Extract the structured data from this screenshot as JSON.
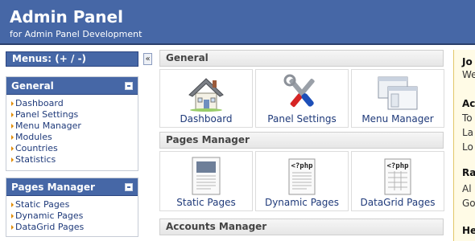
{
  "header": {
    "title": "Admin Panel",
    "subtitle": "for Admin Panel Development"
  },
  "menus_bar": {
    "label": "Menus: (+ / -)"
  },
  "collapse_button": {
    "glyph": "«"
  },
  "sidebar": {
    "general": {
      "title": "General",
      "items": [
        "Dashboard",
        "Panel Settings",
        "Menu Manager",
        "Modules",
        "Countries",
        "Statistics"
      ]
    },
    "pages_manager": {
      "title": "Pages Manager",
      "items": [
        "Static Pages",
        "Dynamic Pages",
        "DataGrid Pages"
      ]
    }
  },
  "main": {
    "general": {
      "title": "General",
      "tiles": [
        "Dashboard",
        "Panel Settings",
        "Menu Manager"
      ]
    },
    "pages_manager": {
      "title": "Pages Manager",
      "tiles": [
        "Static Pages",
        "Dynamic Pages",
        "DataGrid Pages"
      ]
    },
    "accounts_manager": {
      "title": "Accounts Manager"
    }
  },
  "right_panel": {
    "lines": [
      "Jo",
      "We",
      "Ac",
      "To",
      "La",
      "Lo",
      "Ra",
      "Al",
      "Go",
      "He"
    ]
  },
  "colors": {
    "header_bg": "#4667a6",
    "link": "#1f3a7a",
    "bullet": "#e08a00",
    "right_bg": "#fffbe6"
  }
}
